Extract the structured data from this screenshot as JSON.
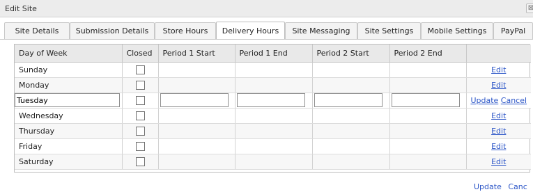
{
  "dialog": {
    "title": "Edit Site",
    "close_glyph": "⊠"
  },
  "tabs": [
    {
      "label": "Site Details"
    },
    {
      "label": "Submission Details"
    },
    {
      "label": "Store Hours"
    },
    {
      "label": "Delivery Hours",
      "active": true
    },
    {
      "label": "Site Messaging"
    },
    {
      "label": "Site Settings"
    },
    {
      "label": "Mobile Settings"
    },
    {
      "label": "PayPal"
    }
  ],
  "grid": {
    "columns": [
      "Day of Week",
      "Closed",
      "Period 1 Start",
      "Period 1 End",
      "Period 2 Start",
      "Period 2 End",
      ""
    ],
    "rows": [
      {
        "day": "Sunday",
        "edit": "Edit"
      },
      {
        "day": "Monday",
        "edit": "Edit"
      },
      {
        "day": "Tuesday",
        "editing": true,
        "update": "Update",
        "cancel": "Cancel"
      },
      {
        "day": "Wednesday",
        "edit": "Edit"
      },
      {
        "day": "Thursday",
        "edit": "Edit"
      },
      {
        "day": "Friday",
        "edit": "Edit"
      },
      {
        "day": "Saturday",
        "edit": "Edit"
      }
    ]
  },
  "footer": {
    "update": "Update",
    "cancel": "Canc"
  },
  "colors": {
    "link": "#2b55c7",
    "header_bg": "#e9e9e9",
    "titlebar_bg": "#ececec"
  }
}
